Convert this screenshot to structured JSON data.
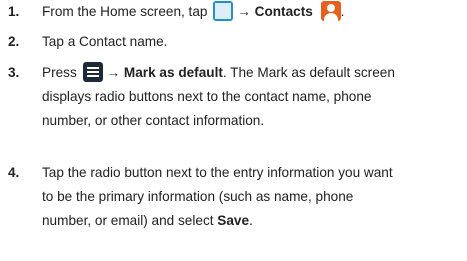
{
  "steps": [
    {
      "number": "1.",
      "lead": "From the Home screen, tap",
      "arrow": "→",
      "target": "Contacts",
      "tail": "."
    },
    {
      "number": "2.",
      "text": "Tap a Contact name."
    },
    {
      "number": "3.",
      "lead": "Press",
      "arrow": "→",
      "target": "Mark as default",
      "line1_rest": ". The Mark as default screen",
      "line2": "displays radio buttons next to the contact name, phone",
      "line3": "number, or other contact information."
    },
    {
      "number": "4.",
      "line1": "Tap the radio button next to the entry information you want",
      "line2": "to be the primary information (such as name, phone",
      "line3_lead": "number, or email) and select",
      "save": "Save",
      "tail": "."
    }
  ],
  "icons": {
    "apps": "apps-icon",
    "contacts": "contacts-icon",
    "menu": "menu-icon"
  },
  "colors": {
    "apps_icon": "#1e8fd6",
    "contacts_icon": "#e8601c",
    "menu_icon": "#1f2a38",
    "text": "#222222"
  }
}
